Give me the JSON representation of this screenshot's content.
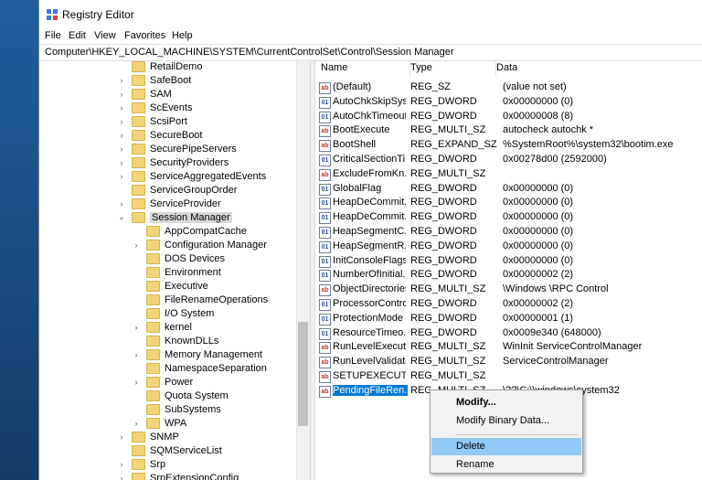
{
  "window": {
    "title": "Registry Editor"
  },
  "menu": [
    "File",
    "Edit",
    "View",
    "Favorites",
    "Help"
  ],
  "address": "Computer\\HKEY_LOCAL_MACHINE\\SYSTEM\\CurrentControlSet\\Control\\Session Manager",
  "tree": [
    {
      "label": "RetailDemo",
      "indent": 0,
      "expander": ""
    },
    {
      "label": "SafeBoot",
      "indent": 0,
      "expander": ">"
    },
    {
      "label": "SAM",
      "indent": 0,
      "expander": ">"
    },
    {
      "label": "ScEvents",
      "indent": 0,
      "expander": ">"
    },
    {
      "label": "ScsiPort",
      "indent": 0,
      "expander": ">"
    },
    {
      "label": "SecureBoot",
      "indent": 0,
      "expander": ">"
    },
    {
      "label": "SecurePipeServers",
      "indent": 0,
      "expander": ">"
    },
    {
      "label": "SecurityProviders",
      "indent": 0,
      "expander": ">"
    },
    {
      "label": "ServiceAggregatedEvents",
      "indent": 0,
      "expander": ">"
    },
    {
      "label": "ServiceGroupOrder",
      "indent": 0,
      "expander": ""
    },
    {
      "label": "ServiceProvider",
      "indent": 0,
      "expander": ">"
    },
    {
      "label": "Session Manager",
      "indent": 0,
      "expander": "v",
      "selected": true
    },
    {
      "label": "AppCompatCache",
      "indent": 1,
      "expander": ""
    },
    {
      "label": "Configuration Manager",
      "indent": 1,
      "expander": ">"
    },
    {
      "label": "DOS Devices",
      "indent": 1,
      "expander": ""
    },
    {
      "label": "Environment",
      "indent": 1,
      "expander": ""
    },
    {
      "label": "Executive",
      "indent": 1,
      "expander": ""
    },
    {
      "label": "FileRenameOperations",
      "indent": 1,
      "expander": ""
    },
    {
      "label": "I/O System",
      "indent": 1,
      "expander": ""
    },
    {
      "label": "kernel",
      "indent": 1,
      "expander": ">"
    },
    {
      "label": "KnownDLLs",
      "indent": 1,
      "expander": ""
    },
    {
      "label": "Memory Management",
      "indent": 1,
      "expander": ">"
    },
    {
      "label": "NamespaceSeparation",
      "indent": 1,
      "expander": ""
    },
    {
      "label": "Power",
      "indent": 1,
      "expander": ">"
    },
    {
      "label": "Quota System",
      "indent": 1,
      "expander": ""
    },
    {
      "label": "SubSystems",
      "indent": 1,
      "expander": ""
    },
    {
      "label": "WPA",
      "indent": 1,
      "expander": ">"
    },
    {
      "label": "SNMP",
      "indent": 0,
      "expander": ">"
    },
    {
      "label": "SQMServiceList",
      "indent": 0,
      "expander": ""
    },
    {
      "label": "Srp",
      "indent": 0,
      "expander": ">"
    },
    {
      "label": "SrpExtensionConfig",
      "indent": 0,
      "expander": ">"
    }
  ],
  "columns": [
    "Name",
    "Type",
    "Data"
  ],
  "values": [
    {
      "icon": "ab",
      "name": "(Default)",
      "type": "REG_SZ",
      "data": "(value not set)"
    },
    {
      "icon": "bin",
      "name": "AutoChkSkipSys...",
      "type": "REG_DWORD",
      "data": "0x00000000 (0)"
    },
    {
      "icon": "bin",
      "name": "AutoChkTimeout",
      "type": "REG_DWORD",
      "data": "0x00000008 (8)"
    },
    {
      "icon": "ab",
      "name": "BootExecute",
      "type": "REG_MULTI_SZ",
      "data": "autocheck autochk *"
    },
    {
      "icon": "ab",
      "name": "BootShell",
      "type": "REG_EXPAND_SZ",
      "data": "%SystemRoot%\\system32\\bootim.exe"
    },
    {
      "icon": "bin",
      "name": "CriticalSectionTi...",
      "type": "REG_DWORD",
      "data": "0x00278d00 (2592000)"
    },
    {
      "icon": "ab",
      "name": "ExcludeFromKn...",
      "type": "REG_MULTI_SZ",
      "data": ""
    },
    {
      "icon": "bin",
      "name": "GlobalFlag",
      "type": "REG_DWORD",
      "data": "0x00000000 (0)"
    },
    {
      "icon": "bin",
      "name": "HeapDeCommit...",
      "type": "REG_DWORD",
      "data": "0x00000000 (0)"
    },
    {
      "icon": "bin",
      "name": "HeapDeCommit...",
      "type": "REG_DWORD",
      "data": "0x00000000 (0)"
    },
    {
      "icon": "bin",
      "name": "HeapSegmentC...",
      "type": "REG_DWORD",
      "data": "0x00000000 (0)"
    },
    {
      "icon": "bin",
      "name": "HeapSegmentR...",
      "type": "REG_DWORD",
      "data": "0x00000000 (0)"
    },
    {
      "icon": "bin",
      "name": "InitConsoleFlags",
      "type": "REG_DWORD",
      "data": "0x00000000 (0)"
    },
    {
      "icon": "bin",
      "name": "NumberOfInitial...",
      "type": "REG_DWORD",
      "data": "0x00000002 (2)"
    },
    {
      "icon": "ab",
      "name": "ObjectDirectories",
      "type": "REG_MULTI_SZ",
      "data": "\\Windows \\RPC Control"
    },
    {
      "icon": "bin",
      "name": "ProcessorControl",
      "type": "REG_DWORD",
      "data": "0x00000002 (2)"
    },
    {
      "icon": "bin",
      "name": "ProtectionMode",
      "type": "REG_DWORD",
      "data": "0x00000001 (1)"
    },
    {
      "icon": "bin",
      "name": "ResourceTimeo...",
      "type": "REG_DWORD",
      "data": "0x0009e340 (648000)"
    },
    {
      "icon": "ab",
      "name": "RunLevelExecute",
      "type": "REG_MULTI_SZ",
      "data": "WinInit ServiceControlManager"
    },
    {
      "icon": "ab",
      "name": "RunLevelValidate",
      "type": "REG_MULTI_SZ",
      "data": "ServiceControlManager"
    },
    {
      "icon": "ab",
      "name": "SETUPEXECUTE",
      "type": "REG_MULTI_SZ",
      "data": ""
    },
    {
      "icon": "ab",
      "name": "PendingFileRen...",
      "type": "REG_MULTI_SZ",
      "data": "\\??\\C:\\\\windows\\system32",
      "selected": true
    }
  ],
  "context_menu": [
    {
      "label": "Modify...",
      "bold": true
    },
    {
      "label": "Modify Binary Data..."
    },
    {
      "label": "Delete",
      "hover": true
    },
    {
      "label": "Rename"
    }
  ],
  "icon_names": {
    "ab": "string-value-icon",
    "bin": "binary-value-icon"
  },
  "colors": {
    "selection": "#0078d7",
    "menu_hover": "#91c9f7",
    "folder": "#f2d477"
  }
}
